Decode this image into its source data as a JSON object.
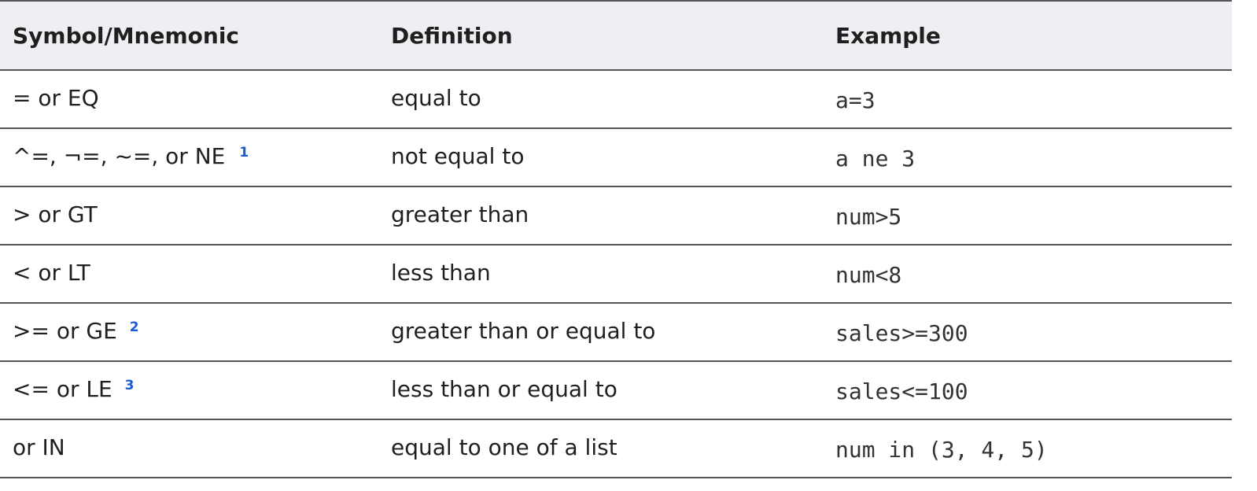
{
  "table": {
    "headers": [
      "Symbol/Mnemonic",
      "Definition",
      "Example"
    ],
    "rows": [
      {
        "symbol": "= or EQ",
        "footnote": "",
        "definition": "equal to",
        "example": "a=3"
      },
      {
        "symbol": "^=, ¬=, ~=, or NE",
        "footnote": "1",
        "definition": "not equal to",
        "example": "a ne 3"
      },
      {
        "symbol": "> or GT",
        "footnote": "",
        "definition": "greater than",
        "example": "num>5"
      },
      {
        "symbol": "< or LT",
        "footnote": "",
        "definition": "less than",
        "example": "num<8"
      },
      {
        "symbol": ">= or GE",
        "footnote": "2",
        "definition": "greater than or equal to",
        "example": "sales>=300"
      },
      {
        "symbol": "<= or LE",
        "footnote": "3",
        "definition": "less than or equal to",
        "example": "sales<=100"
      },
      {
        "symbol": "or IN",
        "footnote": "",
        "definition": "equal to one of a list",
        "example": "num in (3, 4, 5)"
      }
    ]
  },
  "colors": {
    "header_background": "#eeeff2",
    "rule": "#555555",
    "footnote_link": "#1a5ad6"
  }
}
